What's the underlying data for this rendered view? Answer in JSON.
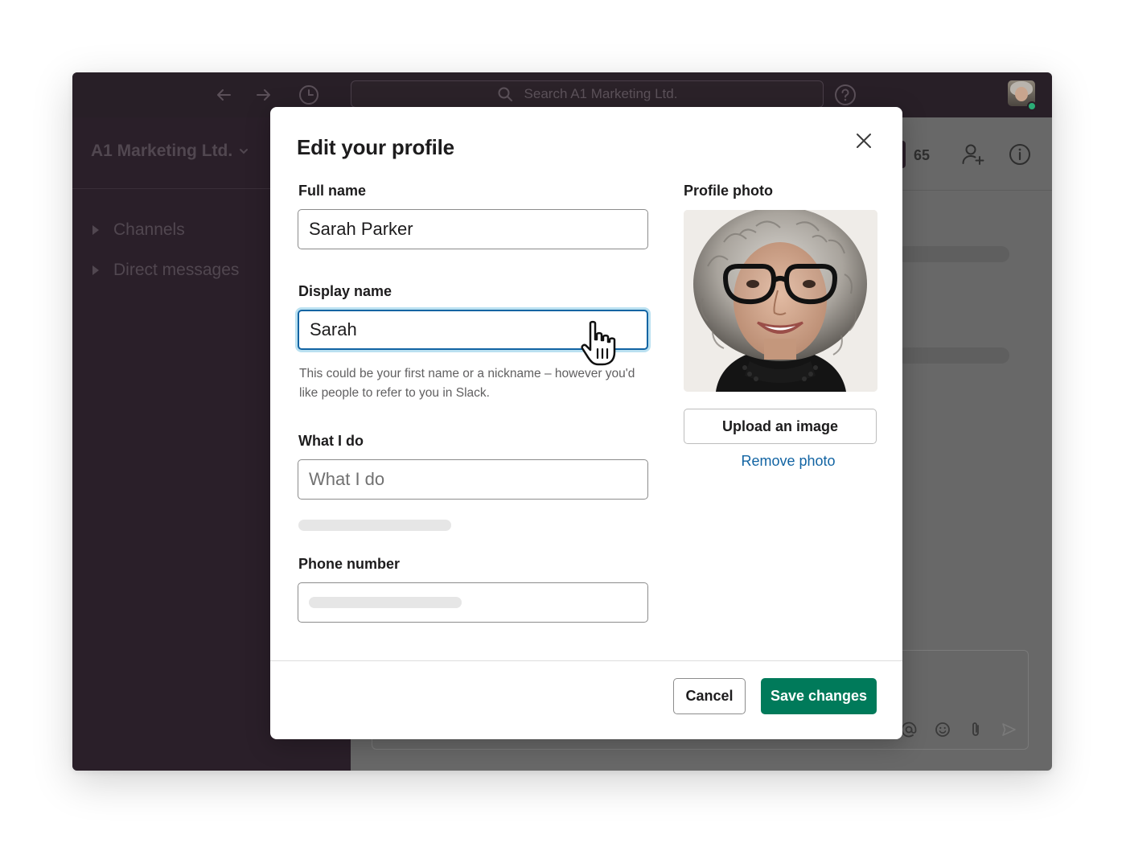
{
  "app": {
    "search_placeholder": "Search A1 Marketing Ltd.",
    "workspace_name": "A1 Marketing Ltd.",
    "sidebar": {
      "items": [
        {
          "label": "Channels"
        },
        {
          "label": "Direct messages"
        }
      ]
    },
    "channel_header": {
      "member_count": "65"
    }
  },
  "modal": {
    "title": "Edit your profile",
    "full_name": {
      "label": "Full name",
      "value": "Sarah Parker"
    },
    "display_name": {
      "label": "Display name",
      "value": "Sarah",
      "hint": "This could be your first name or a nickname – however you'd like people to refer to you in Slack."
    },
    "what_i_do": {
      "label": "What I do",
      "placeholder": "What I do"
    },
    "phone": {
      "label": "Phone number"
    },
    "photo": {
      "label": "Profile photo",
      "upload_label": "Upload an image",
      "remove_label": "Remove photo"
    },
    "footer": {
      "cancel_label": "Cancel",
      "save_label": "Save changes"
    }
  },
  "colors": {
    "aubergine": "#281f27",
    "save_green": "#007a5a",
    "link_blue": "#1264a3",
    "focus_blue": "#1264a3",
    "presence_green": "#2bac76"
  }
}
